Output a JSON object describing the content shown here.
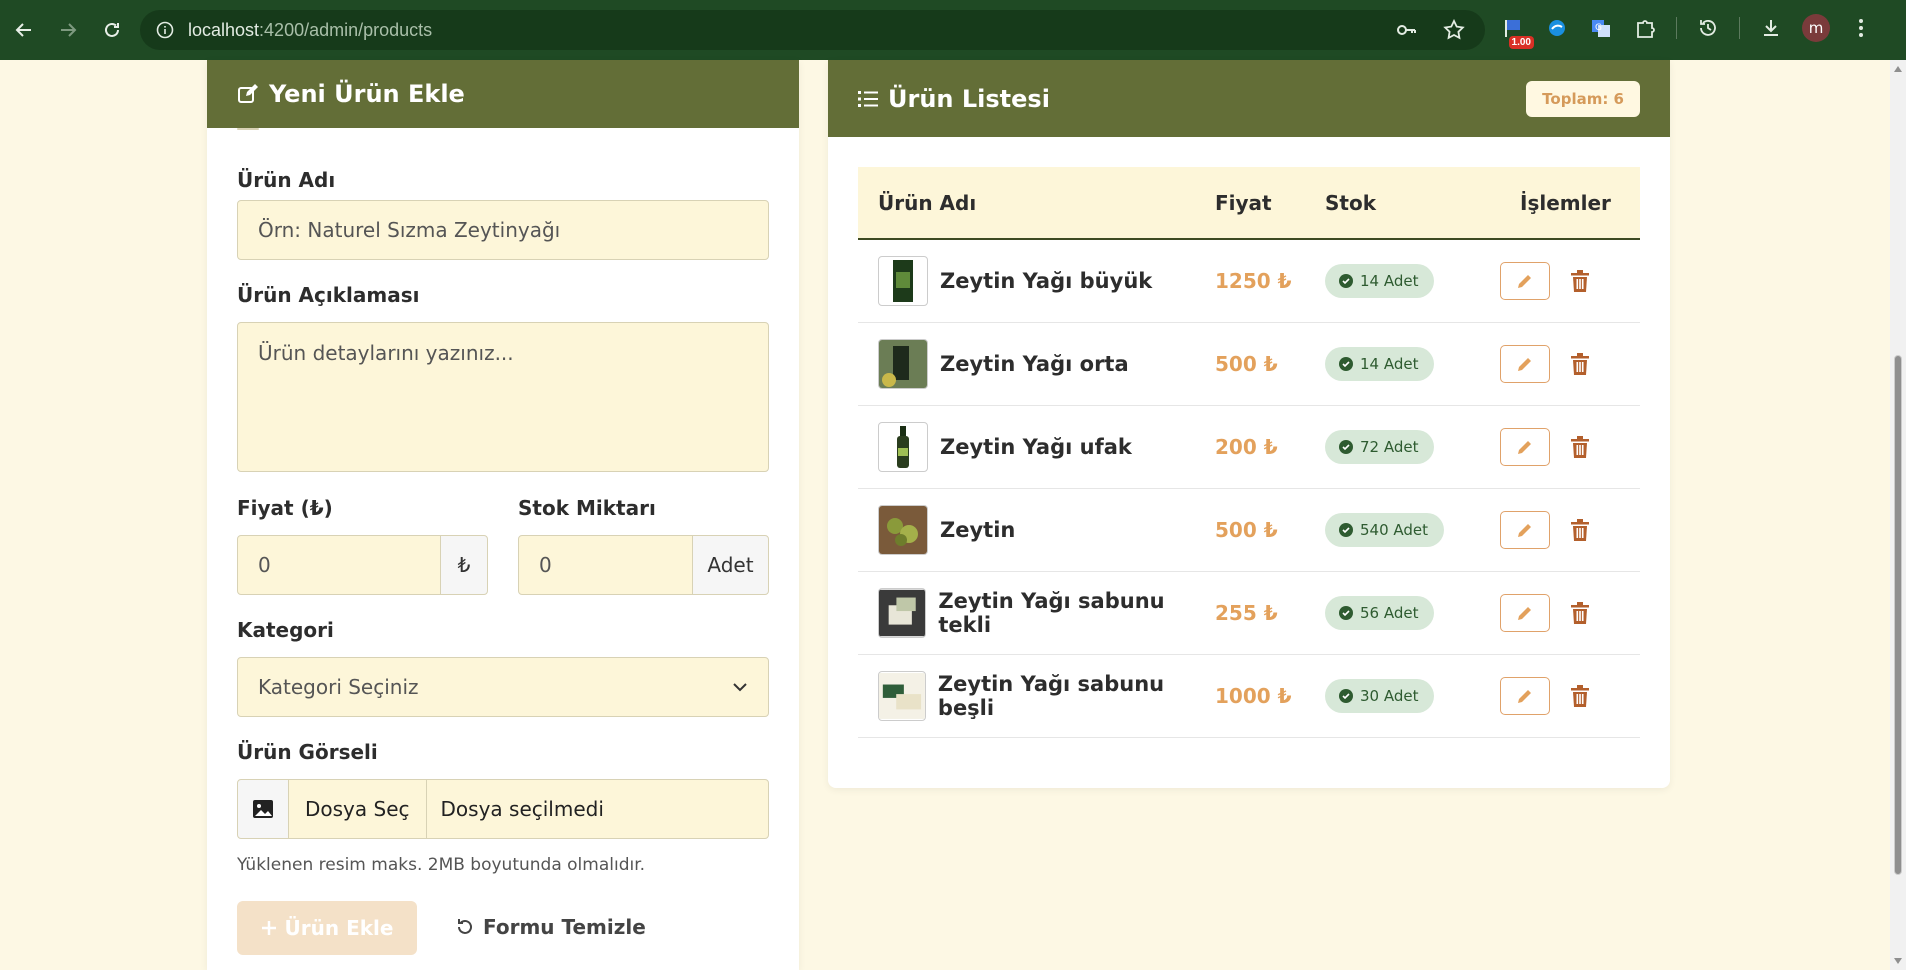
{
  "browser": {
    "url_host": "localhost",
    "url_path": ":4200/admin/products",
    "extension_badge": "1.00",
    "avatar_letter": "m"
  },
  "form": {
    "title": "Yeni Ürün Ekle",
    "name_label": "Ürün Adı",
    "name_placeholder": "Örn: Naturel Sızma Zeytinyağı",
    "desc_label": "Ürün Açıklaması",
    "desc_placeholder": "Ürün detaylarını yazınız...",
    "price_label": "Fiyat (₺)",
    "price_value": "0",
    "price_addon": "₺",
    "stock_label": "Stok Miktarı",
    "stock_value": "0",
    "stock_addon": "Adet",
    "category_label": "Kategori",
    "category_value": "Kategori Seçiniz",
    "image_label": "Ürün Görseli",
    "file_button": "Dosya Seç",
    "file_status": "Dosya seçilmedi",
    "image_hint": "Yüklenen resim maks. 2MB boyutunda olmalıdır.",
    "add_button": "Ürün Ekle",
    "reset_button": "Formu Temizle"
  },
  "list": {
    "title": "Ürün Listesi",
    "total": "Toplam: 6",
    "columns": [
      "Ürün Adı",
      "Fiyat",
      "Stok",
      "İşlemler"
    ],
    "rows": [
      {
        "name": "Zeytin Yağı büyük",
        "price": "1250 ₺",
        "stock": "14 Adet"
      },
      {
        "name": "Zeytin Yağı orta",
        "price": "500 ₺",
        "stock": "14 Adet"
      },
      {
        "name": "Zeytin Yağı ufak",
        "price": "200 ₺",
        "stock": "72 Adet"
      },
      {
        "name": "Zeytin",
        "price": "500 ₺",
        "stock": "540 Adet"
      },
      {
        "name": "Zeytin Yağı sabunu tekli",
        "price": "255 ₺",
        "stock": "56 Adet"
      },
      {
        "name": "Zeytin Yağı sabunu beşli",
        "price": "1000 ₺",
        "stock": "30 Adet"
      }
    ]
  },
  "colors": {
    "header_green": "#636e37",
    "page_bg": "#fdf8e4",
    "accent_orange": "#e3a15c",
    "stock_badge_bg": "#d7e8d8",
    "delete_brown": "#b35f2c"
  }
}
